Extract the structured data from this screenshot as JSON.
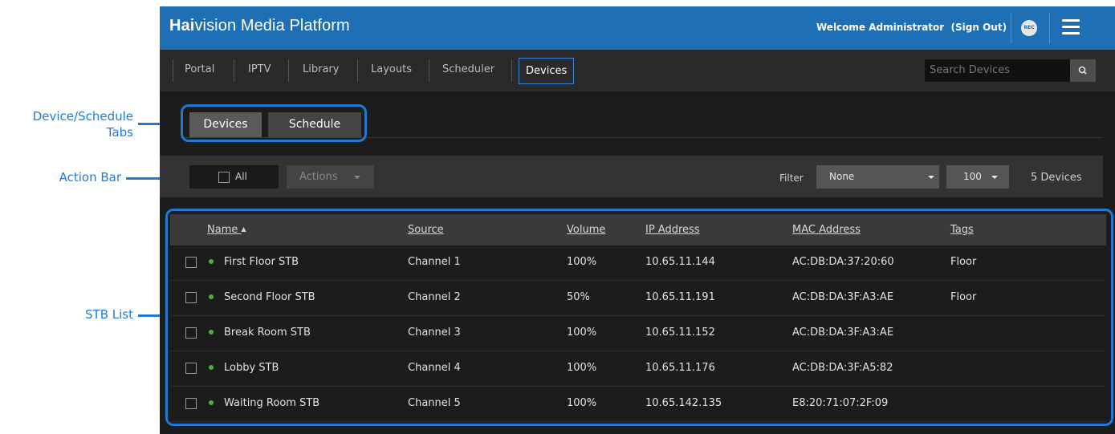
{
  "header": {
    "brand_bold": "Hai",
    "brand_rest": "vision Media Platform",
    "welcome": "Welcome Administrator",
    "sign_out": "(Sign Out)",
    "rec_label": "REC"
  },
  "nav": {
    "items": [
      "Portal",
      "IPTV",
      "Library",
      "Layouts",
      "Scheduler",
      "Devices"
    ],
    "active": "Devices",
    "search_placeholder": "Search Devices"
  },
  "tabs": [
    "Devices",
    "Schedule"
  ],
  "action_bar": {
    "all_label": "All",
    "actions_label": "Actions",
    "filter_label": "Filter",
    "filter_value": "None",
    "page_size": "100",
    "device_count": "5 Devices"
  },
  "table": {
    "columns": [
      "Name",
      "Source",
      "Volume",
      "IP Address",
      "MAC Address",
      "Tags"
    ],
    "sort_indicator": "▲",
    "rows": [
      {
        "name": "First Floor STB",
        "source": "Channel 1",
        "volume": "100%",
        "ip": "10.65.11.144",
        "mac": "AC:DB:DA:37:20:60",
        "tags": "Floor"
      },
      {
        "name": "Second Floor STB",
        "source": "Channel 2",
        "volume": "50%",
        "ip": "10.65.11.191",
        "mac": "AC:DB:DA:3F:A3:AE",
        "tags": "Floor"
      },
      {
        "name": "Break Room STB",
        "source": "Channel 3",
        "volume": "100%",
        "ip": "10.65.11.152",
        "mac": "AC:DB:DA:3F:A3:AE",
        "tags": ""
      },
      {
        "name": "Lobby STB",
        "source": "Channel 4",
        "volume": "100%",
        "ip": "10.65.11.176",
        "mac": "AC:DB:DA:3F:A5:82",
        "tags": ""
      },
      {
        "name": "Waiting Room STB",
        "source": "Channel 5",
        "volume": "100%",
        "ip": "10.65.142.135",
        "mac": "E8:20:71:07:2F:09",
        "tags": ""
      }
    ]
  },
  "callouts": {
    "tabs_line1": "Device/Schedule",
    "tabs_line2": "Tabs",
    "action_bar": "Action Bar",
    "stb_list": "STB List"
  },
  "colors": {
    "header_blue": "#1f6fb5",
    "callout_blue": "#1f7ad6",
    "status_green": "#4caf3c"
  }
}
